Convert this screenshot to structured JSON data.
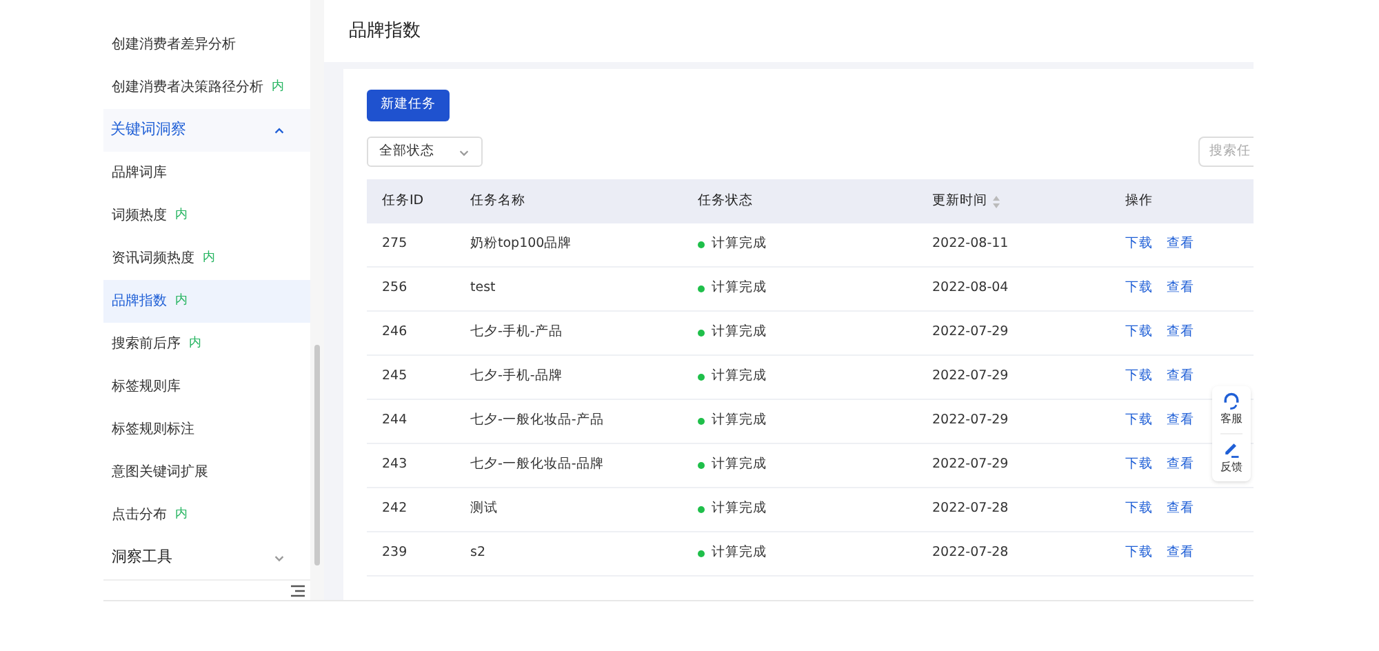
{
  "sidebar": {
    "items": [
      {
        "label": "创建消费者差异分析",
        "kind": "item",
        "selected": false
      },
      {
        "label": "创建消费者决策路径分析",
        "kind": "item",
        "selected": false,
        "badge": "内"
      },
      {
        "label": "关键词洞察",
        "kind": "group",
        "expanded": true
      },
      {
        "label": "品牌词库",
        "kind": "item",
        "selected": false
      },
      {
        "label": "词频热度",
        "kind": "item",
        "selected": false,
        "badge": "内"
      },
      {
        "label": "资讯词频热度",
        "kind": "item",
        "selected": false,
        "badge": "内"
      },
      {
        "label": "品牌指数",
        "kind": "item",
        "selected": true,
        "badge": "内"
      },
      {
        "label": "搜索前后序",
        "kind": "item",
        "selected": false,
        "badge": "内"
      },
      {
        "label": "标签规则库",
        "kind": "item",
        "selected": false
      },
      {
        "label": "标签规则标注",
        "kind": "item",
        "selected": false
      },
      {
        "label": "意图关键词扩展",
        "kind": "item",
        "selected": false
      },
      {
        "label": "点击分布",
        "kind": "item",
        "selected": false,
        "badge": "内"
      },
      {
        "label": "洞察工具",
        "kind": "group",
        "expanded": false
      }
    ]
  },
  "page_title": "品牌指数",
  "new_task_button": "新建任务",
  "status_filter": {
    "value": "全部状态"
  },
  "search": {
    "placeholder": "搜索任"
  },
  "table": {
    "columns": [
      "任务ID",
      "任务名称",
      "任务状态",
      "更新时间",
      "操作"
    ],
    "rows": [
      {
        "id": "275",
        "name": "奶粉top100品牌",
        "status": "计算完成",
        "updated": "2022-08-11",
        "actions": [
          "下载",
          "查看"
        ]
      },
      {
        "id": "256",
        "name": "test",
        "status": "计算完成",
        "updated": "2022-08-04",
        "actions": [
          "下载",
          "查看"
        ]
      },
      {
        "id": "246",
        "name": "七夕-手机-产品",
        "status": "计算完成",
        "updated": "2022-07-29",
        "actions": [
          "下载",
          "查看"
        ]
      },
      {
        "id": "245",
        "name": "七夕-手机-品牌",
        "status": "计算完成",
        "updated": "2022-07-29",
        "actions": [
          "下载",
          "查看"
        ]
      },
      {
        "id": "244",
        "name": "七夕-一般化妆品-产品",
        "status": "计算完成",
        "updated": "2022-07-29",
        "actions": [
          "下载",
          "查看"
        ]
      },
      {
        "id": "243",
        "name": "七夕-一般化妆品-品牌",
        "status": "计算完成",
        "updated": "2022-07-29",
        "actions": [
          "下载",
          "查看"
        ]
      },
      {
        "id": "242",
        "name": "测试",
        "status": "计算完成",
        "updated": "2022-07-28",
        "actions": [
          "下载",
          "查看"
        ]
      },
      {
        "id": "239",
        "name": "s2",
        "status": "计算完成",
        "updated": "2022-07-28",
        "actions": [
          "下载",
          "查看"
        ]
      }
    ]
  },
  "float_tools": [
    {
      "label": "客服",
      "kind": "support"
    },
    {
      "label": "反馈",
      "kind": "feedback"
    }
  ]
}
